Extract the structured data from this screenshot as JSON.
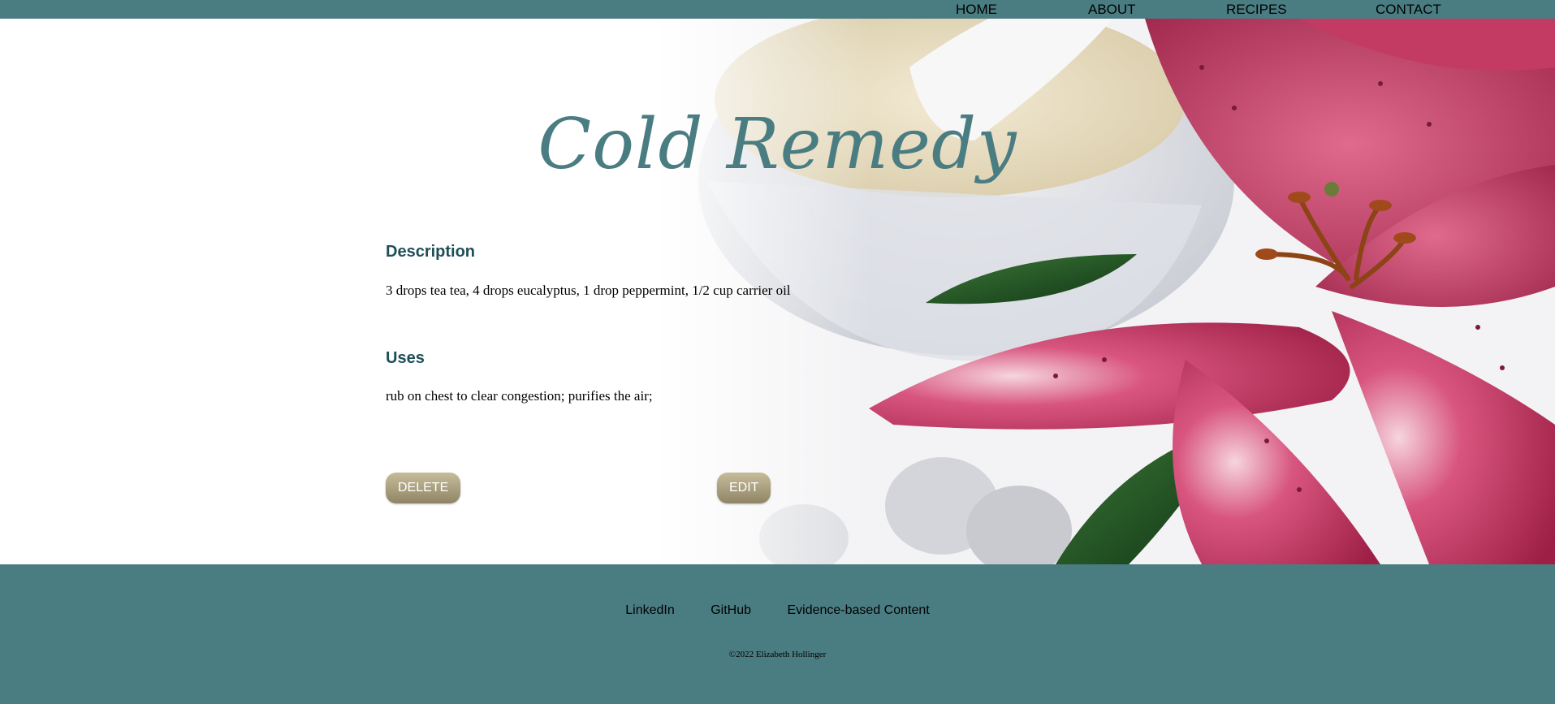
{
  "nav": {
    "items": [
      {
        "label": "HOME"
      },
      {
        "label": "ABOUT"
      },
      {
        "label": "RECIPES"
      },
      {
        "label": "CONTACT"
      }
    ]
  },
  "recipe": {
    "title": "Cold Remedy",
    "description_heading": "Description",
    "description": "3 drops tea tea, 4 drops eucalyptus, 1 drop peppermint, 1/2 cup carrier oil",
    "uses_heading": "Uses",
    "uses": "rub on chest to clear congestion; purifies the air;"
  },
  "actions": {
    "delete_label": "DELETE",
    "edit_label": "EDIT"
  },
  "footer": {
    "links": [
      {
        "label": "LinkedIn"
      },
      {
        "label": "GitHub"
      },
      {
        "label": "Evidence-based Content"
      }
    ],
    "copyright": "©2022 Elizabeth Hollinger"
  },
  "colors": {
    "brand_teal": "#4a7d82",
    "heading_teal": "#1e4f58",
    "button_tan": "#aa9f7f"
  },
  "background_image": "mortar-and-pestle-with-pink-lily"
}
